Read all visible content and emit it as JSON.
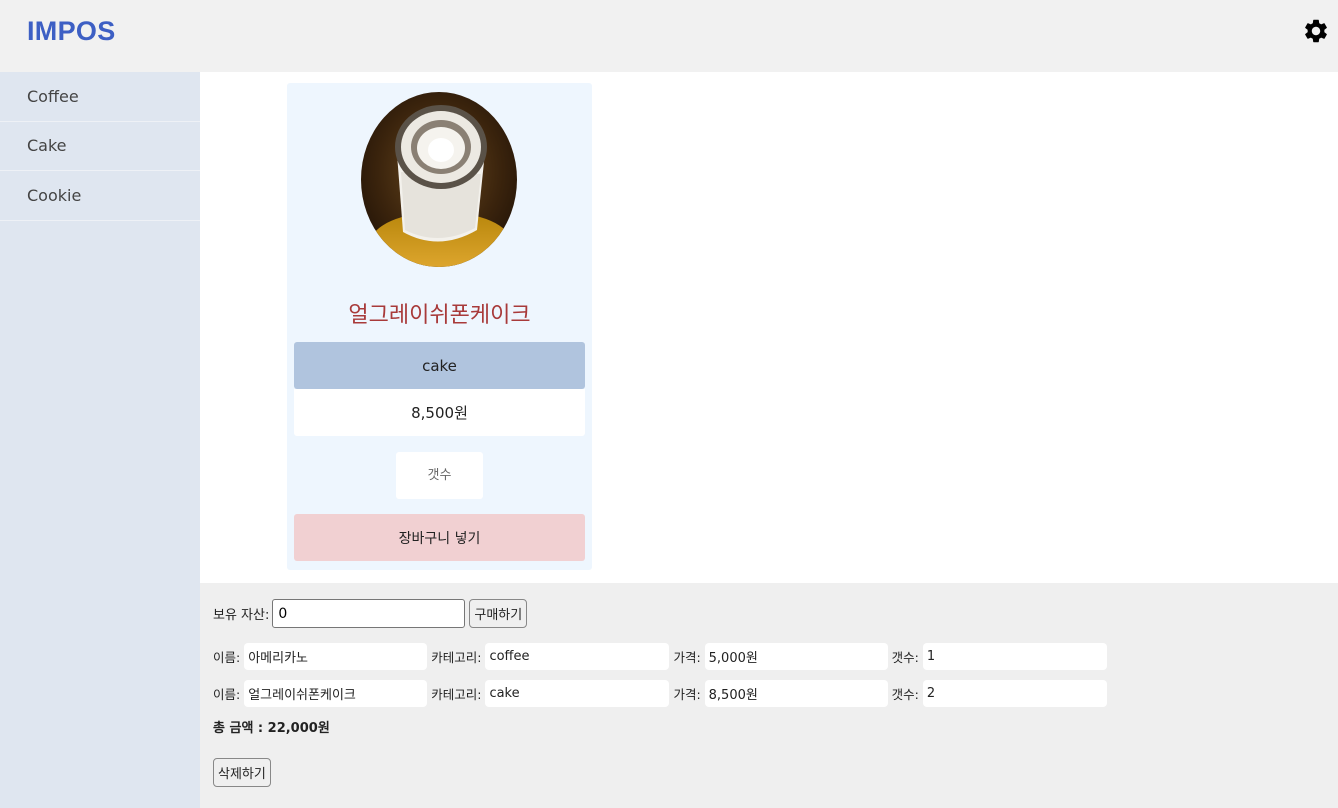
{
  "header": {
    "logo": "IMPOS",
    "settings_icon": "gear-icon"
  },
  "sidebar": {
    "items": [
      {
        "label": "Coffee"
      },
      {
        "label": "Cake"
      },
      {
        "label": "Cookie"
      }
    ]
  },
  "product": {
    "name": "얼그레이쉬폰케이크",
    "category": "cake",
    "price": "8,500원",
    "qty_placeholder": "갯수",
    "add_cart_label": "장바구니 넣기"
  },
  "purchase": {
    "asset_label": "보유 자산:",
    "asset_value": "0",
    "buy_label": "구매하기"
  },
  "cart": {
    "labels": {
      "name": "이름:",
      "category": "카테고리:",
      "price": "가격:",
      "qty": "갯수:"
    },
    "items": [
      {
        "name": "아메리카노",
        "category": "coffee",
        "price": "5,000원",
        "qty": "1"
      },
      {
        "name": "얼그레이쉬폰케이크",
        "category": "cake",
        "price": "8,500원",
        "qty": "2"
      }
    ],
    "total": "총 금액 : 22,000원",
    "delete_label": "삭제하기"
  },
  "colors": {
    "brand": "#3d5fc4",
    "sidebar_bg": "#dfe6f0",
    "card_bg": "#eef6fe",
    "category_bg": "#b0c4de",
    "cart_button_bg": "#f1d0d2",
    "product_name": "#a83a3a"
  }
}
